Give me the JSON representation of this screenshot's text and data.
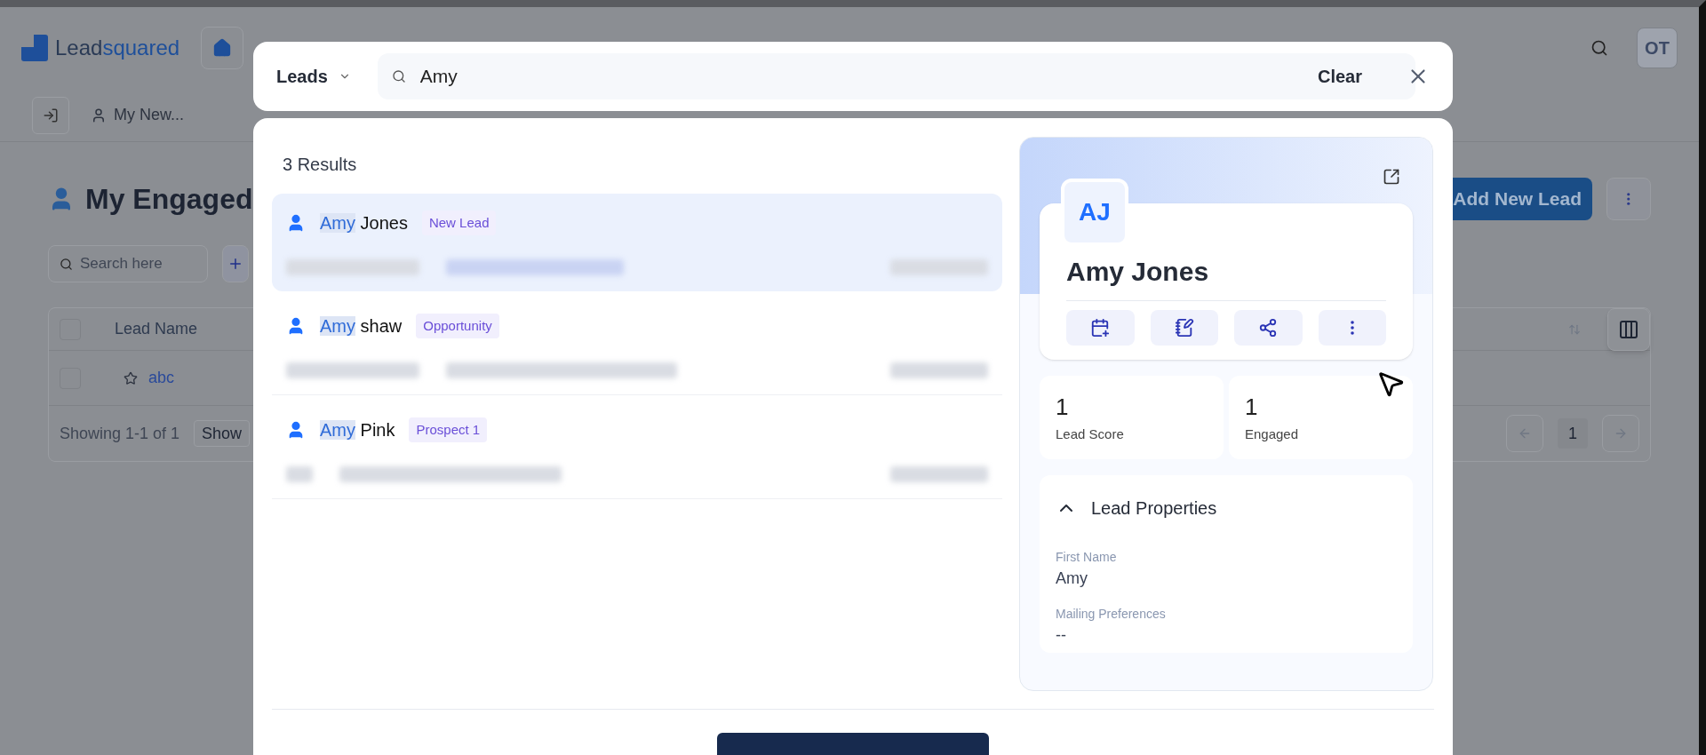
{
  "background_app": {
    "logo": {
      "part1": "Lead",
      "part2": "squared"
    },
    "avatar": "OT",
    "tabs": [
      {
        "label": "My New...",
        "selected": false
      }
    ],
    "page_title": "My Engaged",
    "search": {
      "placeholder": "Search here"
    },
    "add_button": "Add New Lead",
    "table": {
      "header_checked": false,
      "columns": [
        "Lead Name"
      ],
      "rows": [
        {
          "name": "abc",
          "starred": false,
          "checked": false
        }
      ]
    },
    "footer": {
      "showing": "Showing 1-1 of 1",
      "page_size_label": "Show",
      "page": "1"
    }
  },
  "search_bar": {
    "entity": "Leads",
    "query": "Amy",
    "clear": "Clear"
  },
  "results": {
    "count": "3 Results",
    "items": [
      {
        "match": "Amy",
        "rest": "Jones",
        "tag": "New Lead",
        "selected": true
      },
      {
        "match": "Amy",
        "rest": "shaw",
        "tag": "Opportunity",
        "selected": false
      },
      {
        "match": "Amy",
        "rest": "Pink",
        "tag": "Prospect 1",
        "selected": false
      }
    ]
  },
  "preview": {
    "initials": "AJ",
    "name": "Amy Jones",
    "stats": [
      {
        "value": "1",
        "label": "Lead Score"
      },
      {
        "value": "1",
        "label": "Engaged"
      }
    ],
    "properties": {
      "title": "Lead Properties",
      "expanded": true,
      "fields": [
        {
          "label": "First Name",
          "value": "Amy"
        },
        {
          "label": "Mailing Preferences",
          "value": "--"
        }
      ]
    }
  }
}
